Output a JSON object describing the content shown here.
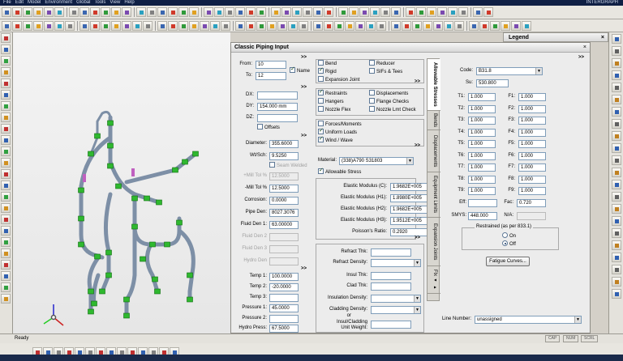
{
  "app": {
    "menu_items": [
      "File",
      "Edit",
      "Model",
      "Environment",
      "Global",
      "Tools",
      "View",
      "Help"
    ],
    "right_title": "INTERGRAPH"
  },
  "legend": {
    "title": "Legend",
    "close": "×"
  },
  "dialog": {
    "title": "Classic Piping Input",
    "close": "×",
    "chevrons": ">>",
    "from_label": "From:",
    "from_value": "10",
    "to_label": "To:",
    "to_value": "12",
    "name_label": "Name",
    "dx_label": "DX:",
    "dx_value": "",
    "dy_label": "DY:",
    "dy_value": "154.000 mm",
    "dz_label": "DZ:",
    "dz_value": "",
    "offsets_label": "Offsets",
    "diameter_label": "Diameter:",
    "diameter_value": "355.6000",
    "wtsch_label": "Wt/Sch:",
    "wtsch_value": "9.5250",
    "seam_label": "Seam Welded",
    "mill_plus_label": "+Mill Tol %",
    "mill_plus_value": "12.5000",
    "mill_minus_label": "-Mill Tol %",
    "mill_minus_value": "12.5000",
    "corrosion_label": "Corrosion:",
    "corrosion_value": "0.0000",
    "pipe_den_label": "Pipe Den:",
    "pipe_den_value": "8027.3076",
    "fluid_den1_label": "Fluid Den 1:",
    "fluid_den1_value": "63.00000",
    "fluid_den2_label": "Fluid Den 2",
    "fluid_den3_label": "Fluid Den 3",
    "hydro_den_label": "Hydro Den",
    "temp1_label": "Temp 1:",
    "temp1_value": "100.0000",
    "temp2_label": "Temp 2:",
    "temp2_value": "-20.0000",
    "temp3_label": "Temp 3:",
    "temp3_value": "",
    "pressure1_label": "Pressure 1:",
    "pressure1_value": "45.0000",
    "pressure2_label": "Pressure 2:",
    "pressure2_value": "",
    "hydro_press_label": "Hydro Press:",
    "hydro_press_value": "67.5000",
    "element_checks": {
      "bend": "Bend",
      "reducer": "Reducer",
      "rigid": "Rigid",
      "sifs": "SIFs & Tees",
      "expansion": "Expansion Joint",
      "restraints": "Restraints",
      "displacements": "Displacements",
      "hangers": "Hangers",
      "flange": "Flange Checks",
      "nozzle_flex": "Nozzle Flex",
      "nozzle_lmt": "Nozzle Lmt Check",
      "forces": "Forces/Moments",
      "uniform": "Uniform Loads",
      "wind": "Wind / Wave"
    },
    "material_label": "Material:",
    "material_value": "(338)A790 S31803",
    "allowable_stress_label": "Allowable Stress",
    "em_c_label": "Elastic Modulus (C):",
    "em_c_value": "1.9682E+005",
    "em_h1_label": "Elastic Modulus (H1):",
    "em_h1_value": "1.8980E+005",
    "em_h2_label": "Elastic Modulus (H2):",
    "em_h2_value": "1.9682E+005",
    "em_h3_label": "Elastic Modulus (H3):",
    "em_h3_value": "1.9512E+005",
    "poisson_label": "Poisson's Ratio:",
    "poisson_value": "0.2920",
    "refract_thk_label": "Refract Thk:",
    "refract_den_label": "Refract Density:",
    "insul_thk_label": "Insul Thk:",
    "clad_thk_label": "Clad Thk:",
    "insul_den_label": "Insulation Density:",
    "clad_den_label": "Cladding Density:",
    "or_label": "or",
    "insul_clad_label": "Insul/Cladding",
    "unit_weight_label": "Unit Weight:",
    "vtabs": [
      "Allowable Stresses",
      "Bends",
      "Displacements",
      "Equipment Limits",
      "Expansion Joints",
      "Flx ◂ ▸"
    ],
    "code_label": "Code:",
    "code_value": "B31.8",
    "su_label": "Su:",
    "su_value": "530.800",
    "t_labels": [
      "T1:",
      "T2:",
      "T3:",
      "T4:",
      "T5:",
      "T6:",
      "T7:",
      "T8:",
      "T9:"
    ],
    "t_values": [
      "1.000",
      "1.000",
      "1.000",
      "1.000",
      "1.000",
      "1.000",
      "1.000",
      "1.000",
      "1.000"
    ],
    "f_labels": [
      "F1:",
      "F2:",
      "F3:",
      "F4:",
      "F5:",
      "F6:",
      "F7:",
      "F8:",
      "F9:"
    ],
    "f_values": [
      "1.000",
      "1.000",
      "1.000",
      "1.000",
      "1.000",
      "1.000",
      "1.000",
      "1.000",
      "1.000"
    ],
    "eff_label": "Eff:",
    "eff_value": "",
    "fac_label": "Fac:",
    "fac_value": "0.720",
    "smys_label": "SMYS:",
    "smys_value": "448.000",
    "na_label": "N/A:",
    "restrained_label": "Restrained (as per 833.1)",
    "on_label": "On",
    "off_label": "Off",
    "fatigue_button": "Fatigue Curves...",
    "line_number_label": "Line Number:",
    "line_number_value": "unassigned"
  },
  "status": {
    "text": "Ready",
    "cap": "CAP",
    "num": "NUM",
    "scrl": "SCRL"
  }
}
